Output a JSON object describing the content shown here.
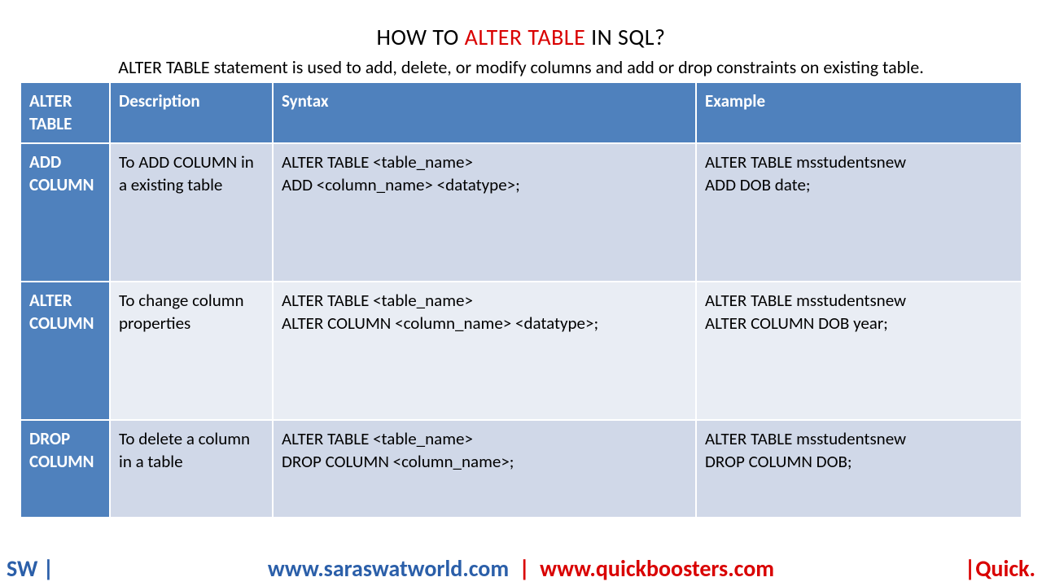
{
  "title": {
    "p1": "HOW TO ",
    "p2": "ALTER TABLE",
    "p3": " IN SQL?"
  },
  "subtitle": "ALTER TABLE statement is used to add, delete, or modify columns and add or drop constraints on existing table.",
  "headers": {
    "c1": "ALTER TABLE",
    "c2": "Description",
    "c3": "Syntax",
    "c4": "Example"
  },
  "rows": [
    {
      "label": "ADD COLUMN",
      "desc": "To ADD COLUMN in a existing table",
      "syntax": "ALTER TABLE <table_name>\nADD <column_name> <datatype>;",
      "example": "ALTER TABLE msstudentsnew\nADD DOB date;"
    },
    {
      "label": "ALTER COLUMN",
      "desc": "To change column properties",
      "syntax": "ALTER TABLE <table_name>\nALTER COLUMN <column_name> <datatype>;",
      "example": "ALTER TABLE msstudentsnew\nALTER COLUMN DOB year;"
    },
    {
      "label": "DROP COLUMN",
      "desc": "To delete a column in a table",
      "syntax": "ALTER TABLE <table_name>\nDROP COLUMN <column_name>;",
      "example": "ALTER TABLE msstudentsnew\nDROP COLUMN DOB;"
    }
  ],
  "footer": {
    "left": "SW |",
    "center_blue": "www.saraswatworld.com",
    "center_sep": "|",
    "center_red": "www.quickboosters.com",
    "right": "|Quick."
  }
}
